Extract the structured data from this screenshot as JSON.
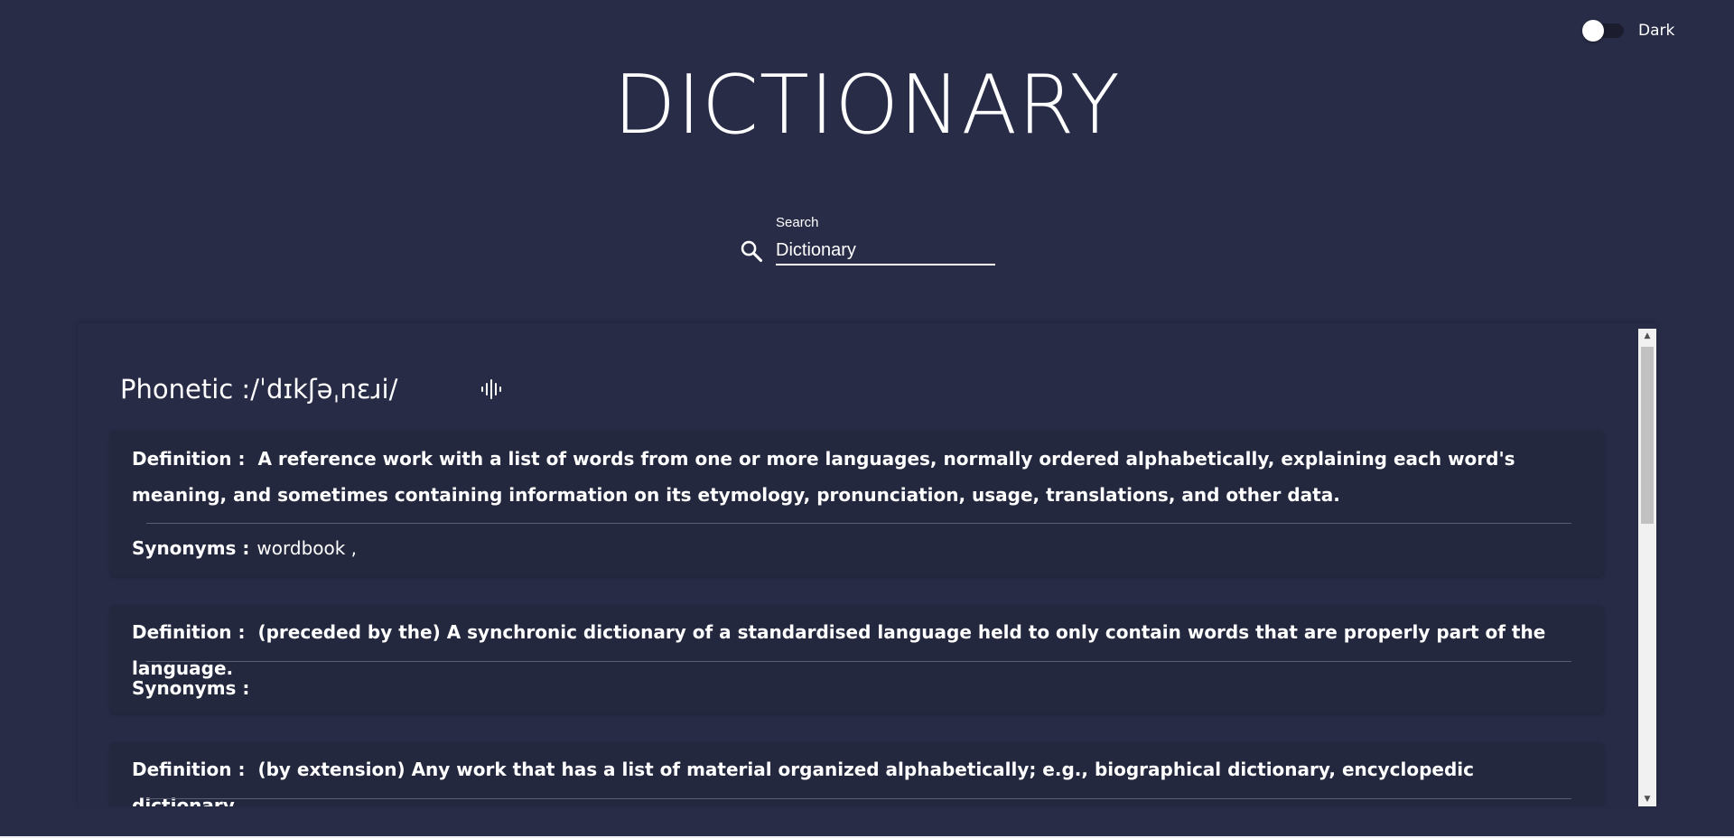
{
  "theme_toggle": {
    "label": "Dark",
    "checked": false
  },
  "app_title": "DICTIONARY",
  "search": {
    "label": "Search",
    "value": "Dictionary",
    "icon": "search-icon"
  },
  "phonetic": {
    "label": "Phonetic :",
    "text": "/ˈdɪkʃəˌnɛɹi/",
    "audio_icon": "audio-waveform-icon"
  },
  "definition_label": "Definition :",
  "synonyms_label": "Synonyms :",
  "definitions": [
    {
      "text": "A reference work with a list of words from one or more languages, normally ordered alphabetically, explaining each word's meaning, and sometimes containing information on its etymology, pronunciation, usage, translations, and other data.",
      "synonyms": "wordbook ,"
    },
    {
      "text": "(preceded by the) A synchronic dictionary of a standardised language held to only contain words that are properly part of the language.",
      "synonyms": ""
    },
    {
      "text": "(by extension) Any work that has a list of material organized alphabetically; e.g., biographical dictionary, encyclopedic dictionary.",
      "synonyms": ""
    }
  ],
  "colors": {
    "background": "#282c47",
    "card": "#24283f",
    "text": "#ffffff"
  }
}
